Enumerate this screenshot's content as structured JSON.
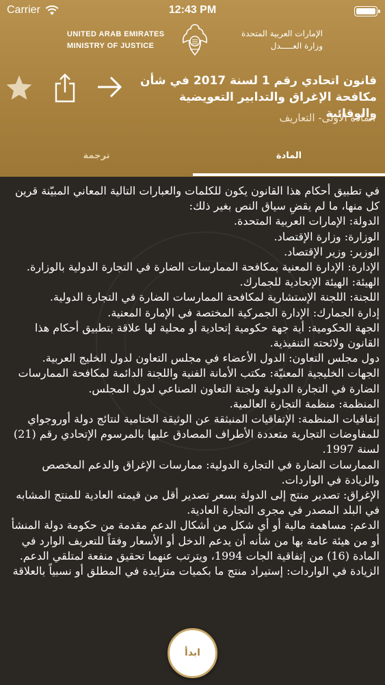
{
  "status": {
    "carrier": "Carrier",
    "time": "12:43 PM"
  },
  "ministry": {
    "en_line1": "UNITED ARAB EMIRATES",
    "en_line2": "MINISTRY OF JUSTICE",
    "ar_line1": "الإمارات العربية المتحدة",
    "ar_line2": "وزارة العـــــدل"
  },
  "toolbar": {
    "favorite_icon": "star-icon",
    "share_icon": "share-icon",
    "next_icon": "arrow-right-icon"
  },
  "law": {
    "title": "قانون اتحادي  رقم 1 لسنة 2017 في شأن مكافحة الإغراق والتدابير التعويضية والوقائية",
    "article_name": "المادة الأولى- التعاريف"
  },
  "tabs": {
    "article": "المادة",
    "translation": "ترجمة"
  },
  "article_lines": [
    "في تطبيق أحكام هذا القانون يكون للكلمات والعبارات التالية المعاني المبيّنة قرين كل منها، ما لم يقضِ سياق النص بغير ذلك:",
    "الدولة: الإمارات العربية المتحدة.",
    "الوزارة: وزارة الإقتصاد.",
    "الوزير: وزير الإقتصاد.",
    "الإدارة: الإدارة المعنية بمكافحة الممارسات الضارة في التجارة الدولية بالوزارة.",
    "الهيئة: الهيئة الإتحادية للجمارك.",
    "اللجنة: اللجنة الإستشارية لمكافحة الممارسات الضارة في التجارة الدولية.",
    "إدارة الجمارك: الإدارة الجمركية المختصة في الإمارة المعنية.",
    "الجهة الحكومية: أية جهة حكومية إتحادية أو محلية لها علاقة بتطبيق أحكام هذا القانون ولائحته التنفيذية.",
    "دول مجلس التعاون: الدول الأعضاء في مجلس التعاون لدول الخليج العربية.",
    "الجهات الخليجية المعنيّة: مكتب الأمانة الفنية واللجنة الدائمة لمكافحة الممارسات الضارة في التجارة الدولية ولجنة التعاون الصناعي لدول المجلس.",
    "المنظمة: منظمة التجارة العالمية.",
    "إتفاقيات المنظمة: الإتفاقيات المنبثقة عن الوثيقة الختامية لنتائج دولة أوروجواي للمفاوضات التجارية متعددة الأطراف المصادق عليها بالمرسوم الإتحادي رقم (21) لسنة 1997.",
    "الممارسات الضارة في التجارة الدولية: ممارسات الإغراق والدعم المخصص والزيادة في الواردات.",
    "الإغراق: تصدير منتج إلى الدولة بسعر تصدير أقل من قيمته العادية للمنتج المشابه في البلد المصدر في مجرى التجارة العادية.",
    "الدعم: مساهمة مالية أو أي شكل من أشكال الدعم مقدمة من حكومة دولة المنشأ أو من هيئة عامة بها من شأنه أن يدعم الدخل أو الأسعار وفقاً للتعريف الوارد في المادة (16) من إتفاقية الجات 1994، ويترتب عنهما تحقيق منفعة لمتلقي الدعم.",
    "الزيادة في الواردات: إستيراد منتج ما بكميات متزايدة في المطلق أو نسبياً بالعلاقة"
  ],
  "start_button": "ابدأ"
}
